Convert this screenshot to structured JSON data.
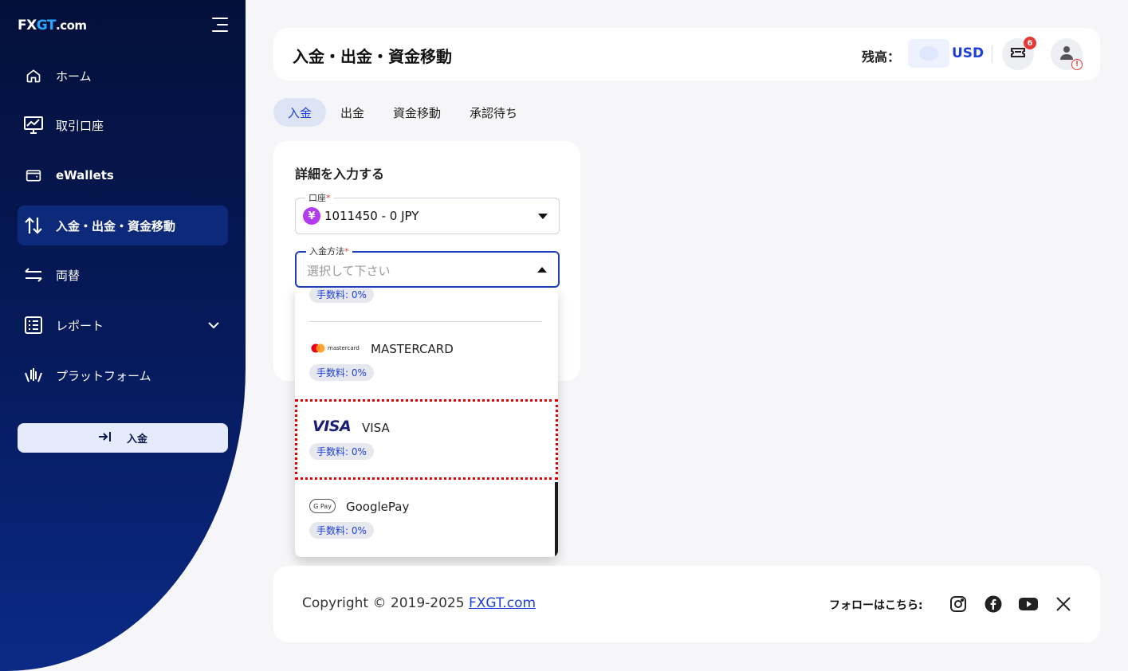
{
  "brand": {
    "logo_prefix": "FX",
    "logo_accent": "GT",
    "logo_suffix": ".com"
  },
  "sidebar": {
    "items": [
      {
        "label": "ホーム",
        "icon": "home-icon"
      },
      {
        "label": "取引口座",
        "icon": "chart-monitor-icon"
      },
      {
        "label": "eWallets",
        "icon": "wallet-icon"
      },
      {
        "label": "入金・出金・資金移動",
        "icon": "transfer-arrows-icon",
        "active": true
      },
      {
        "label": "両替",
        "icon": "exchange-icon"
      },
      {
        "label": "レポート",
        "icon": "report-icon"
      },
      {
        "label": "プラットフォーム",
        "icon": "platform-icon"
      }
    ],
    "deposit_button": "入金"
  },
  "header": {
    "title": "入金・出金・資金移動",
    "balance_label": "残高：",
    "currency": "USD",
    "notification_count": "6"
  },
  "tabs": [
    {
      "label": "入金",
      "active": true
    },
    {
      "label": "出金"
    },
    {
      "label": "資金移動"
    },
    {
      "label": "承認待ち"
    }
  ],
  "form": {
    "title": "詳細を入力する",
    "account_label": "口座",
    "account_value": "1011450 - 0 JPY",
    "method_label": "入金方法",
    "method_placeholder": "選択して下さい",
    "required_mark": "*"
  },
  "dropdown": {
    "options": [
      {
        "name": "",
        "fee": "手数料: 0%"
      },
      {
        "name": "MASTERCARD",
        "logo_text": "mastercard",
        "fee": "手数料: 0%"
      },
      {
        "name": "VISA",
        "logo_text": "VISA",
        "fee": "手数料: 0%"
      },
      {
        "name": "GooglePay",
        "logo_text": "G Pay",
        "fee": "手数料: 0%"
      }
    ]
  },
  "footer": {
    "copyright": "Copyright © 2019-2025 ",
    "link": "FXGT.com",
    "follow_label": "フォローはこちら:",
    "socials": [
      "instagram-icon",
      "facebook-icon",
      "youtube-icon",
      "x-icon"
    ]
  },
  "colors": {
    "accent": "#1e40d8",
    "sidebar": "#061b5e",
    "highlight": "#e00000",
    "avatar_yen": "#b33cf0"
  }
}
